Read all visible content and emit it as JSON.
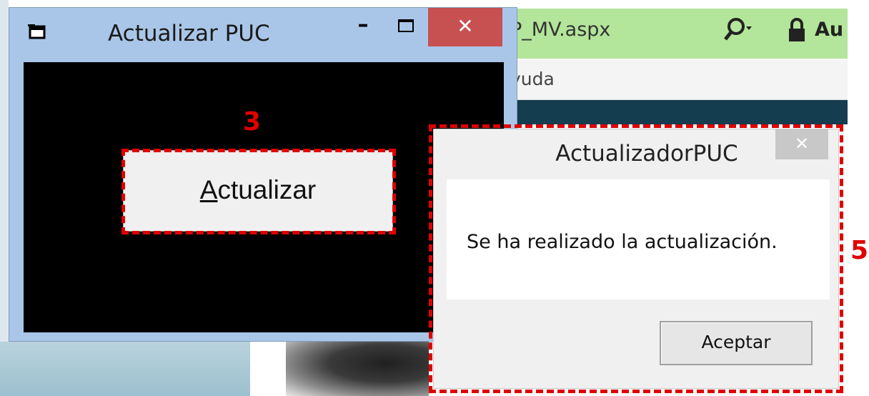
{
  "background_browser": {
    "url_fragment": "P_MV.aspx",
    "search_icon": "search-dropdown-icon",
    "lock_icon": "lock-icon",
    "partial_text": "Au",
    "menu_fragment": "yuda"
  },
  "main_window": {
    "title": "Actualizar PUC",
    "app_icon": "app-window-icon",
    "minimize_glyph": "–",
    "maximize_icon": "maximize-icon",
    "close_glyph": "✕",
    "button_label": "Actualizar",
    "button_mnemonic": "A"
  },
  "annotations": {
    "marker_3": "3",
    "marker_5": "5"
  },
  "dialog": {
    "title": "ActualizadorPUC",
    "close_glyph": "✕",
    "message": "Se ha realizado la actualización.",
    "ok_label": "Aceptar"
  },
  "colors": {
    "annotation_red": "#e00000",
    "window_frame": "#a9c6e8",
    "close_button": "#c75050",
    "address_bar": "#b3e59a"
  }
}
